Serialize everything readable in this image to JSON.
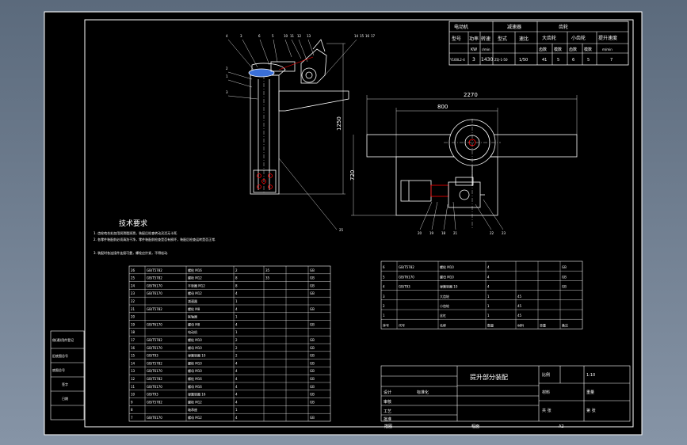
{
  "motor_table": {
    "headers": [
      "电动机",
      "减速器",
      "齿轮"
    ],
    "subheaders": [
      "型号",
      "功率",
      "转速",
      "型式",
      "速比",
      "大齿轮",
      "小齿轮",
      "提升速度"
    ],
    "units": [
      "",
      "KW",
      "r/min",
      "",
      "",
      "齿数",
      "模数",
      "齿数",
      "模数",
      "m/min"
    ],
    "values": [
      "Y100L2-4",
      "3",
      "1430",
      "ZQ-1-50",
      "1/50",
      "41",
      "5",
      "6",
      "5",
      "7"
    ]
  },
  "dimensions": {
    "height_left": "1250",
    "width_total": "2270",
    "width_inner": "800",
    "height_right": "720"
  },
  "part_labels_top": [
    "4",
    "3",
    "6",
    "5",
    "10",
    "11",
    "12",
    "13",
    "14",
    "15",
    "16",
    "17"
  ],
  "part_labels_left": [
    "2",
    "1",
    "3"
  ],
  "part_labels_bottom": [
    "20",
    "19",
    "18",
    "21",
    "22",
    "23"
  ],
  "part_label_25": "25",
  "tech": {
    "title": "技术要求",
    "lines": [
      "1. 齿轮啮合处加用润滑脂润滑，装配后检查转动灵活无卡死.",
      "2. 各零件装配前必须清洗干净，零件装配前检查是否有损坏，装配后检查运转是否正常.",
      "3. 装配时各连接件连接可靠，螺栓应拧紧，不得松动."
    ]
  },
  "bom_left": [
    [
      "26",
      "GB/T5782",
      "螺栓 M16",
      "2",
      "35",
      "",
      "GB"
    ],
    [
      "25",
      "GB/T5782",
      "螺栓 M12",
      "8",
      "35",
      "",
      "GB"
    ],
    [
      "24",
      "GB/T6170",
      "平垫圈 M12",
      "8",
      "",
      "",
      "GB"
    ],
    [
      "23",
      "GB/T6170",
      "螺母 M12",
      "4",
      "",
      "",
      "GB"
    ],
    [
      "22",
      "",
      "减速器",
      "1",
      "",
      "",
      ""
    ],
    [
      "21",
      "GB/T5782",
      "螺栓 M8",
      "4",
      "",
      "",
      "GB"
    ],
    [
      "20",
      "",
      "联轴器",
      "1",
      "",
      "",
      ""
    ],
    [
      "19",
      "GB/T6170",
      "螺母 M8",
      "4",
      "",
      "",
      "GB"
    ],
    [
      "18",
      "",
      "电动机",
      "1",
      "",
      "",
      ""
    ],
    [
      "17",
      "GB/T5782",
      "螺栓 M10",
      "2",
      "",
      "",
      "GB"
    ],
    [
      "16",
      "GB/T6170",
      "螺母 M10",
      "2",
      "",
      "",
      "GB"
    ],
    [
      "15",
      "GB/T93",
      "弹簧垫圈 10",
      "2",
      "",
      "",
      "GB"
    ],
    [
      "14",
      "GB/T5782",
      "螺栓 M10",
      "4",
      "",
      "",
      "GB"
    ],
    [
      "13",
      "GB/T6170",
      "螺母 M10",
      "4",
      "",
      "",
      "GB"
    ],
    [
      "12",
      "GB/T5782",
      "螺栓 M16",
      "4",
      "",
      "",
      "GB"
    ],
    [
      "11",
      "GB/T6170",
      "螺母 M16",
      "4",
      "",
      "",
      "GB"
    ],
    [
      "10",
      "GB/T93",
      "弹簧垫圈 16",
      "4",
      "",
      "",
      "GB"
    ],
    [
      "9",
      "GB/T5782",
      "螺栓 M12",
      "4",
      "",
      "",
      "GB"
    ],
    [
      "8",
      "",
      "轴承座",
      "1",
      "",
      "",
      ""
    ],
    [
      "7",
      "GB/T6170",
      "螺母 M12",
      "4",
      "",
      "",
      "GB"
    ]
  ],
  "bom_right": [
    [
      "6",
      "GB/T5782",
      "螺栓 M10",
      "4",
      "",
      "",
      "GB"
    ],
    [
      "5",
      "GB/T6170",
      "螺母 M10",
      "4",
      "",
      "",
      "GB"
    ],
    [
      "4",
      "GB/T93",
      "弹簧垫圈 10",
      "4",
      "",
      "",
      "GB"
    ],
    [
      "3",
      "",
      "大齿轮",
      "1",
      "45",
      "",
      ""
    ],
    [
      "2",
      "",
      "小齿轮",
      "1",
      "45",
      "",
      ""
    ],
    [
      "1",
      "",
      "丝杠",
      "1",
      "45",
      "",
      ""
    ]
  ],
  "bom_header": [
    "序号",
    "代号",
    "名称",
    "数量",
    "材料",
    "单重",
    "备注"
  ],
  "side_labels": [
    "借(通)用件登记",
    "旧底图总号",
    "底图总号",
    "签字",
    "日期"
  ],
  "title_block": {
    "drawing_name": "提升部分装配",
    "scale_label": "比例",
    "scale": "1:10",
    "sheet": "第 张",
    "designer": "设计",
    "checker": "审核",
    "process": "工艺",
    "approve": "批准",
    "std": "标准化",
    "weight": "重量",
    "material": "材料",
    "count": "共 张"
  },
  "footer": [
    "描图",
    "幅面",
    "A2"
  ]
}
